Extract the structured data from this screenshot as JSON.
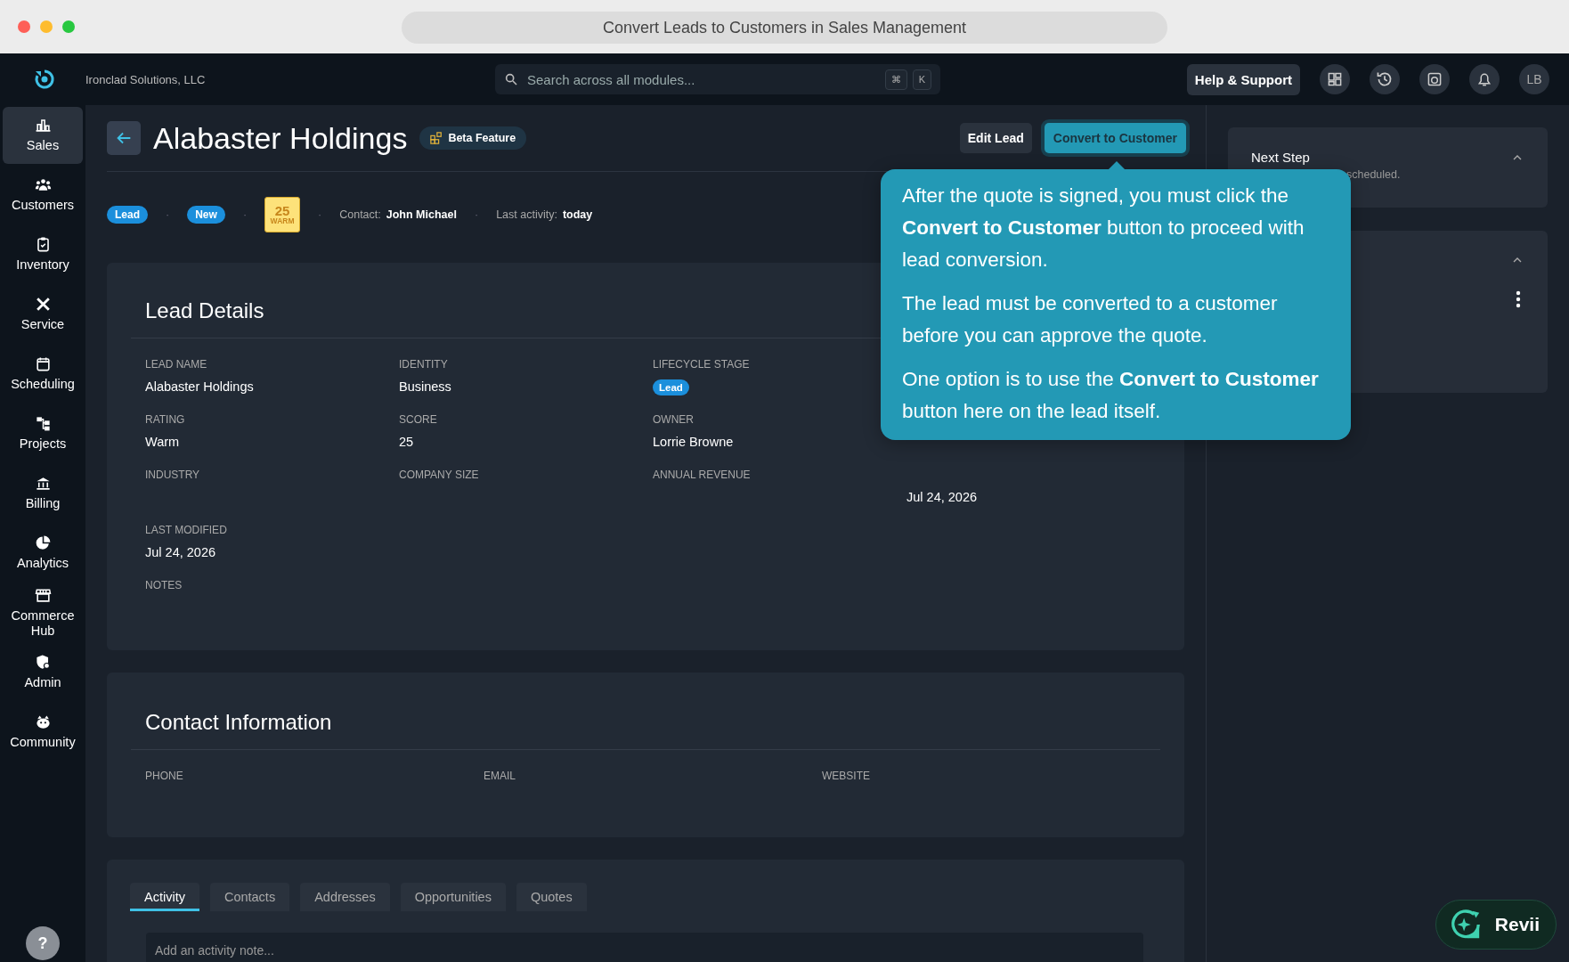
{
  "window": {
    "title": "Convert Leads to Customers in Sales Management"
  },
  "app_bar": {
    "company": "Ironclad Solutions, LLC",
    "search": {
      "placeholder": "Search across all modules...",
      "keys": [
        "⌘",
        "K"
      ]
    },
    "help_button": "Help & Support",
    "avatar": "LB"
  },
  "sidebar": {
    "items": [
      {
        "label": "Sales",
        "selected": true
      },
      {
        "label": "Customers",
        "selected": false
      },
      {
        "label": "Inventory",
        "selected": false
      },
      {
        "label": "Service",
        "selected": false
      },
      {
        "label": "Scheduling",
        "selected": false
      },
      {
        "label": "Projects",
        "selected": false
      },
      {
        "label": "Billing",
        "selected": false
      },
      {
        "label": "Analytics",
        "selected": false
      },
      {
        "label": "Commerce Hub",
        "selected": false
      },
      {
        "label": "Admin",
        "selected": false
      },
      {
        "label": "Community",
        "selected": false
      }
    ],
    "help": "?"
  },
  "header": {
    "title": "Alabaster Holdings",
    "badge": "Beta Feature",
    "buttons": [
      {
        "label": "Edit Lead",
        "kind": "secondary",
        "highlighted": false
      },
      {
        "label": "Convert to Customer",
        "kind": "primary",
        "highlighted": true
      }
    ]
  },
  "meta": {
    "separator": "·",
    "stage": "Lead",
    "status": "New",
    "score": {
      "value": "25",
      "rating": "WARM"
    },
    "contact_label": "Contact:",
    "contact": "John Michael",
    "activity_label": "Last activity:",
    "activity": "today"
  },
  "lead_details": {
    "title": "Lead Details",
    "rows": [
      [
        {
          "label": "LEAD NAME",
          "value": "Alabaster Holdings",
          "kind": "text"
        },
        {
          "label": "IDENTITY",
          "value": "Business",
          "kind": "text"
        },
        {
          "label": "LIFECYCLE STAGE",
          "value": "Lead",
          "kind": "pill"
        }
      ],
      [
        {
          "label": "RATING",
          "value": "Warm",
          "kind": "text"
        },
        {
          "label": "SCORE",
          "value": "25",
          "kind": "text"
        },
        {
          "label": "OWNER",
          "value": "Lorrie Browne",
          "kind": "text"
        }
      ],
      [
        {
          "label": "INDUSTRY"
        },
        {
          "label": "COMPANY SIZE"
        },
        {
          "label": "ANNUAL REVENUE"
        },
        {
          "value": "Jul 24, 2026",
          "kind": "text"
        }
      ],
      [
        {
          "label": "LAST MODIFIED",
          "value": "Jul 24, 2026",
          "kind": "text"
        }
      ],
      [
        {
          "label": "NOTES"
        }
      ]
    ]
  },
  "contact_info": {
    "title": "Contact Information",
    "fields": [
      {
        "label": "PHONE"
      },
      {
        "label": "EMAIL"
      },
      {
        "label": "WEBSITE"
      }
    ]
  },
  "tabs": [
    {
      "label": "Activity",
      "selected": true
    },
    {
      "label": "Contacts",
      "selected": false
    },
    {
      "label": "Addresses",
      "selected": false
    },
    {
      "label": "Opportunities",
      "selected": false
    },
    {
      "label": "Quotes",
      "selected": false
    }
  ],
  "activity_input": {
    "placeholder": "Add an activity note..."
  },
  "right_panel": {
    "cards": [
      {
        "title": "Next Step",
        "text": "scheduled.",
        "expanded": true,
        "menu": false
      },
      {
        "expanded": true,
        "menu": true
      }
    ]
  },
  "tooltip": {
    "paragraphs": [
      "After the quote is signed, you must click the **Convert to Customer** button to proceed with lead conversion.",
      "The lead must be converted to a customer before you can approve the quote.",
      "One option is to use the **Convert to Customer** button here on the lead itself."
    ]
  },
  "assistant_button": {
    "label": "Revii"
  }
}
